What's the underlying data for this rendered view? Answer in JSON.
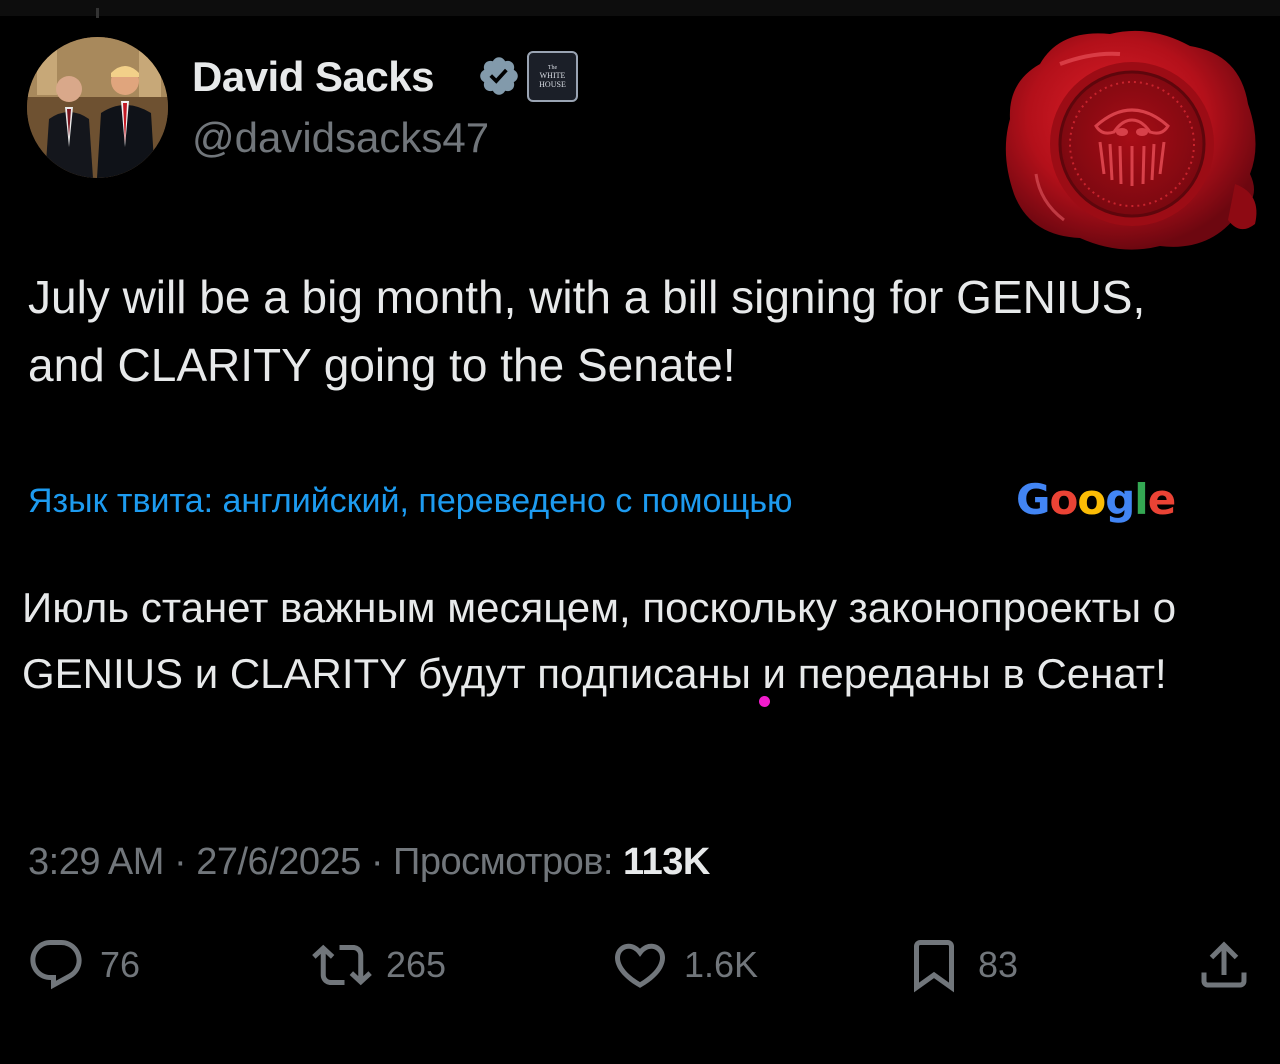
{
  "author": {
    "name": "David Sacks",
    "handle": "@davidsacks47",
    "verified_icon": "verified-badge-icon",
    "affiliation_badge": {
      "line1": "The",
      "line2": "WHITE",
      "line3": "HOUSE"
    }
  },
  "tweet": {
    "text_en": "July will be a big month, with a bill signing for GENIUS, and CLARITY going to the Senate!",
    "translation_note": "Язык твита: английский, переведено с помощью",
    "translation_provider": "Google",
    "text_ru": "Июль станет важным месяцем, поскольку законопроекты о GENIUS и CLARITY будут подписаны и переданы в Сенат!"
  },
  "meta": {
    "time": "3:29 AM",
    "separator": "·",
    "date": "27/6/2025",
    "views_label": "Просмотров:",
    "views_value": "113K"
  },
  "actions": {
    "replies": "76",
    "reposts": "265",
    "likes": "1.6K",
    "bookmarks": "83"
  },
  "colors": {
    "background": "#000000",
    "text": "#e7e9ea",
    "secondary": "#71767b",
    "link": "#1d9bf0",
    "verified": "#829aab",
    "seal_red": "#b3101a"
  }
}
